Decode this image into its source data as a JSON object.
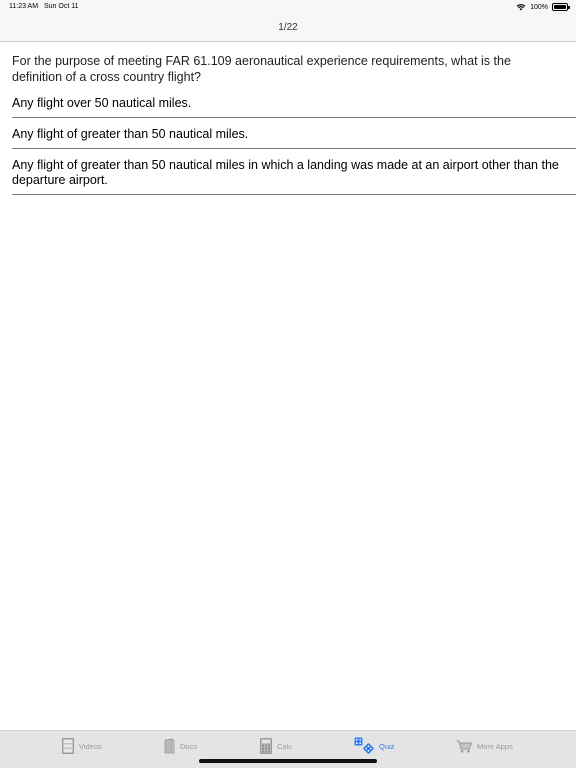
{
  "status_bar": {
    "time": "11:23 AM",
    "date": "Sun Oct 11",
    "battery": "100%"
  },
  "nav": {
    "title": "1/22"
  },
  "quiz": {
    "question": "For the purpose of meeting FAR 61.109 aeronautical experience requirements, what is the definition of a cross country flight?",
    "answers": [
      "Any flight over 50 nautical miles.",
      "Any flight of greater than 50 nautical miles.",
      "Any flight of greater than 50 nautical miles in which a landing was made at an airport other than the departure airport."
    ]
  },
  "tabbar": {
    "tabs": [
      {
        "label": "Videos",
        "icon": "videos-icon"
      },
      {
        "label": "Docs",
        "icon": "docs-icon"
      },
      {
        "label": "Calc",
        "icon": "calculator-icon"
      },
      {
        "label": "Quiz",
        "icon": "dice-icon"
      },
      {
        "label": "More Apps",
        "icon": "cart-icon"
      }
    ],
    "active": "Quiz"
  },
  "colors": {
    "accent": "#2f7cf6",
    "inactive": "#9a9a9a",
    "tabbar_bg": "#e4e4e4"
  }
}
